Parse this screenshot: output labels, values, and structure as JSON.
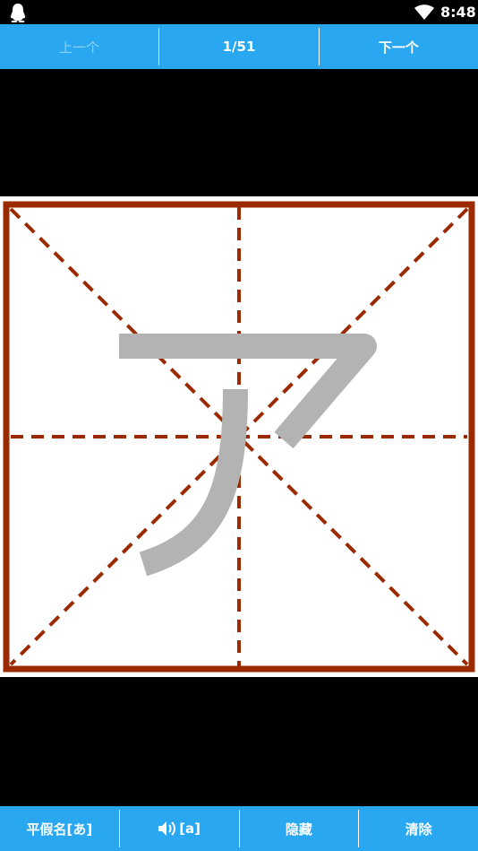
{
  "status_bar": {
    "time": "8:48",
    "app_icon": "penguin-icon",
    "wifi_icon": "wifi-icon"
  },
  "nav": {
    "prev_label": "上一个",
    "counter": "1/51",
    "next_label": "下一个"
  },
  "board": {
    "character": "ア",
    "grid_color": "#9b2a00",
    "glyph_color": "#b3b3b3"
  },
  "toolbar": {
    "hiragana_label": "平假名[あ]",
    "sound_icon": "speaker-icon",
    "sound_label": "[a]",
    "hide_label": "隐藏",
    "clear_label": "清除"
  },
  "colors": {
    "accent": "#29a7f0",
    "disabled_text": "#8ed0f6"
  }
}
